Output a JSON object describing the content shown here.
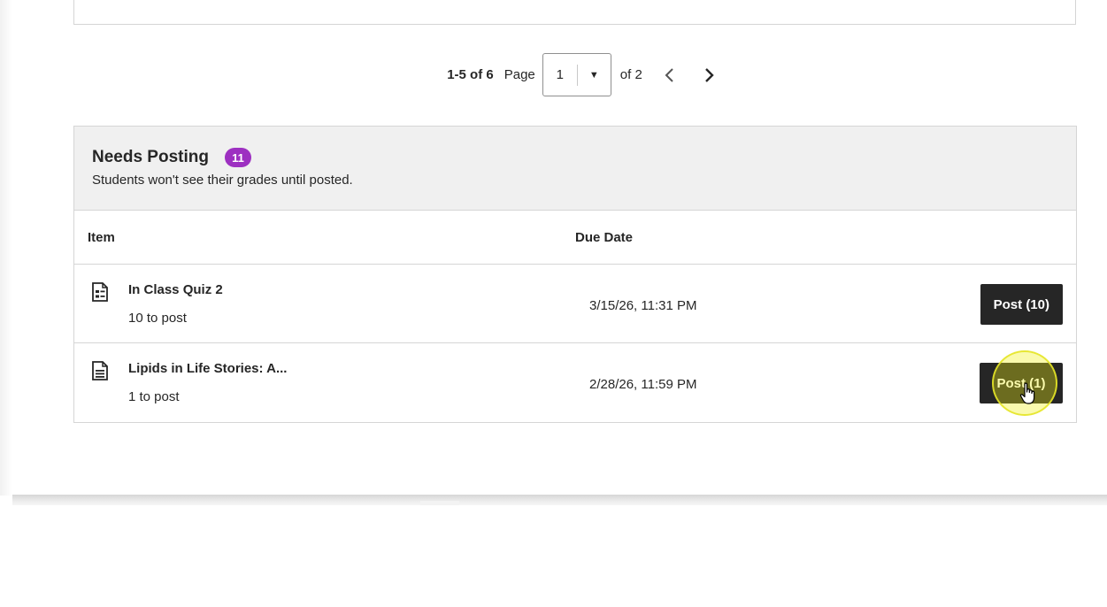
{
  "pagination": {
    "range": "1-5 of 6",
    "page_label": "Page",
    "current_page": "1",
    "of_label": "of 2"
  },
  "needs_posting": {
    "title": "Needs Posting",
    "count": "11",
    "subtitle": "Students won't see their grades until posted.",
    "columns": {
      "item": "Item",
      "due_date": "Due Date"
    },
    "rows": [
      {
        "name": "In Class Quiz 2",
        "sub": "10 to post",
        "due": "3/15/26, 11:31 PM",
        "button": "Post (10)",
        "icon": "quiz-icon"
      },
      {
        "name": "Lipids in Life Stories: A...",
        "sub": "1 to post",
        "due": "2/28/26, 11:59 PM",
        "button": "Post (1)",
        "icon": "document-icon"
      }
    ]
  },
  "colors": {
    "badge": "#9d30c1",
    "button": "#262626",
    "header_bg": "#f0f0f0"
  }
}
